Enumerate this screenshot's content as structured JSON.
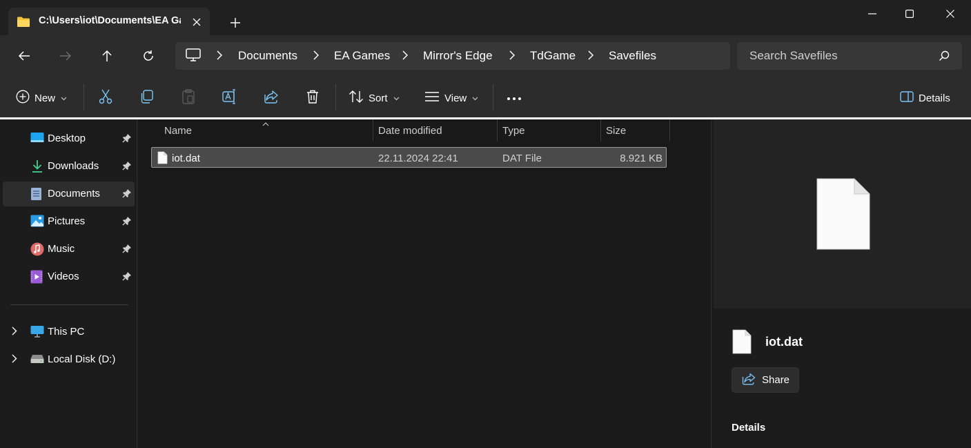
{
  "window": {
    "tab_title": "C:\\Users\\iot\\Documents\\EA Games\\Mirror's Edge\\TdGame\\Savefiles",
    "new_tab_glyph": "+",
    "controls": [
      "minimize-icon",
      "maximize-icon",
      "close-icon"
    ]
  },
  "nav": {
    "breadcrumbs": [
      {
        "label": "Documents"
      },
      {
        "label": "EA Games"
      },
      {
        "label": "Mirror's Edge"
      },
      {
        "label": "TdGame"
      },
      {
        "label": "Savefiles"
      }
    ],
    "search_placeholder": "Search Savefiles"
  },
  "commands": {
    "new_label": "New",
    "sort_label": "Sort",
    "view_label": "View",
    "details_label": "Details",
    "more_glyph": "•••"
  },
  "sidebar": {
    "quick_access": [
      {
        "label": "Desktop",
        "icon": "desktop-icon",
        "pinned": true
      },
      {
        "label": "Downloads",
        "icon": "downloads-icon",
        "pinned": true
      },
      {
        "label": "Documents",
        "icon": "documents-icon",
        "pinned": true,
        "selected": true
      },
      {
        "label": "Pictures",
        "icon": "pictures-icon",
        "pinned": true
      },
      {
        "label": "Music",
        "icon": "music-icon",
        "pinned": true
      },
      {
        "label": "Videos",
        "icon": "videos-icon",
        "pinned": true
      }
    ],
    "drives": [
      {
        "label": "This PC",
        "icon": "this-pc-icon"
      },
      {
        "label": "Local Disk (D:)",
        "icon": "drive-icon"
      }
    ]
  },
  "filelist": {
    "columns": [
      "Name",
      "Date modified",
      "Type",
      "Size"
    ],
    "files": [
      {
        "name": "iot.dat",
        "date_modified": "22.11.2024 22:41",
        "type": "DAT File",
        "size": "8.921 KB",
        "selected": true
      }
    ]
  },
  "details_pane": {
    "file_name": "iot.dat",
    "share_label": "Share",
    "section_heading": "Details"
  },
  "colors": {
    "accent": "#4cc2ff",
    "background": "#202020",
    "selection": "#4a4a4a"
  }
}
